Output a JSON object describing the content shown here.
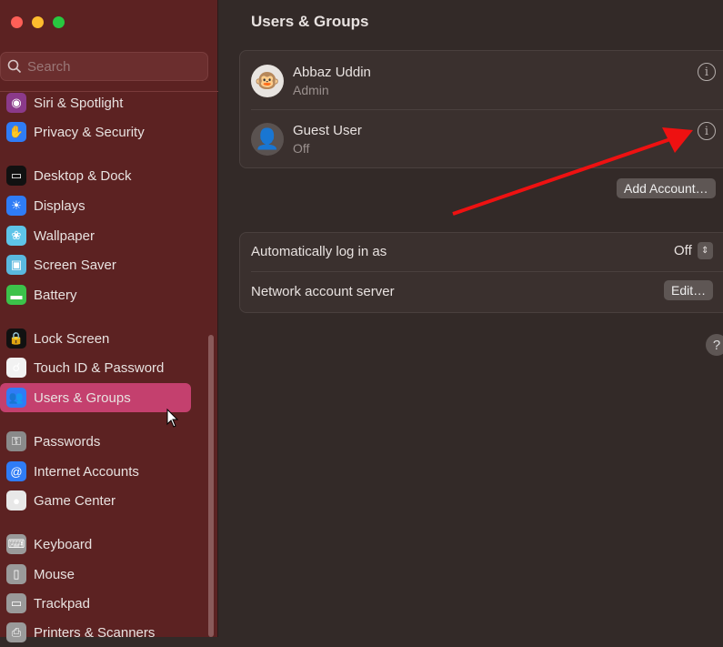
{
  "window": {
    "title": "Users & Groups"
  },
  "search": {
    "placeholder": "Search"
  },
  "sidebar": {
    "items": [
      {
        "label": "Siri & Spotlight",
        "icon": "siri-icon",
        "color": "#8b3a8a",
        "glyph": "◉"
      },
      {
        "label": "Privacy & Security",
        "icon": "hand-icon",
        "color": "#2f7cf6",
        "glyph": "✋"
      },
      {
        "label": "Desktop & Dock",
        "icon": "dock-icon",
        "color": "#111111",
        "glyph": "▭"
      },
      {
        "label": "Displays",
        "icon": "sun-icon",
        "color": "#2f7cf6",
        "glyph": "☀"
      },
      {
        "label": "Wallpaper",
        "icon": "flower-icon",
        "color": "#5ec4e8",
        "glyph": "❀"
      },
      {
        "label": "Screen Saver",
        "icon": "screensaver-icon",
        "color": "#5ab8de",
        "glyph": "▣"
      },
      {
        "label": "Battery",
        "icon": "battery-icon",
        "color": "#3cc24a",
        "glyph": "▬"
      },
      {
        "label": "Lock Screen",
        "icon": "lock-icon",
        "color": "#111111",
        "glyph": "🔒"
      },
      {
        "label": "Touch ID & Password",
        "icon": "fingerprint-icon",
        "color": "#f2f2f2",
        "glyph": "☌"
      },
      {
        "label": "Users & Groups",
        "icon": "users-icon",
        "color": "#2f7cf6",
        "glyph": "👥"
      },
      {
        "label": "Passwords",
        "icon": "key-icon",
        "color": "#8a8a8a",
        "glyph": "⚿"
      },
      {
        "label": "Internet Accounts",
        "icon": "at-icon",
        "color": "#2f7cf6",
        "glyph": "@"
      },
      {
        "label": "Game Center",
        "icon": "gamecenter-icon",
        "color": "#e8e8e8",
        "glyph": "●"
      },
      {
        "label": "Keyboard",
        "icon": "keyboard-icon",
        "color": "#9a9a9a",
        "glyph": "⌨"
      },
      {
        "label": "Mouse",
        "icon": "mouse-icon",
        "color": "#9a9a9a",
        "glyph": "▯"
      },
      {
        "label": "Trackpad",
        "icon": "trackpad-icon",
        "color": "#9a9a9a",
        "glyph": "▭"
      },
      {
        "label": "Printers & Scanners",
        "icon": "printer-icon",
        "color": "#9a9a9a",
        "glyph": "⎙"
      }
    ],
    "selected": "Users & Groups"
  },
  "users": [
    {
      "name": "Abbaz Uddin",
      "role": "Admin",
      "avatar": "🐵"
    },
    {
      "name": "Guest User",
      "role": "Off",
      "avatar": "👤"
    }
  ],
  "add_account_label": "Add Account…",
  "settings": {
    "auto_login_label": "Automatically log in as",
    "auto_login_value": "Off",
    "network_label": "Network account server",
    "edit_label": "Edit…"
  },
  "help_label": "?",
  "annotation_color": "#ee1111"
}
